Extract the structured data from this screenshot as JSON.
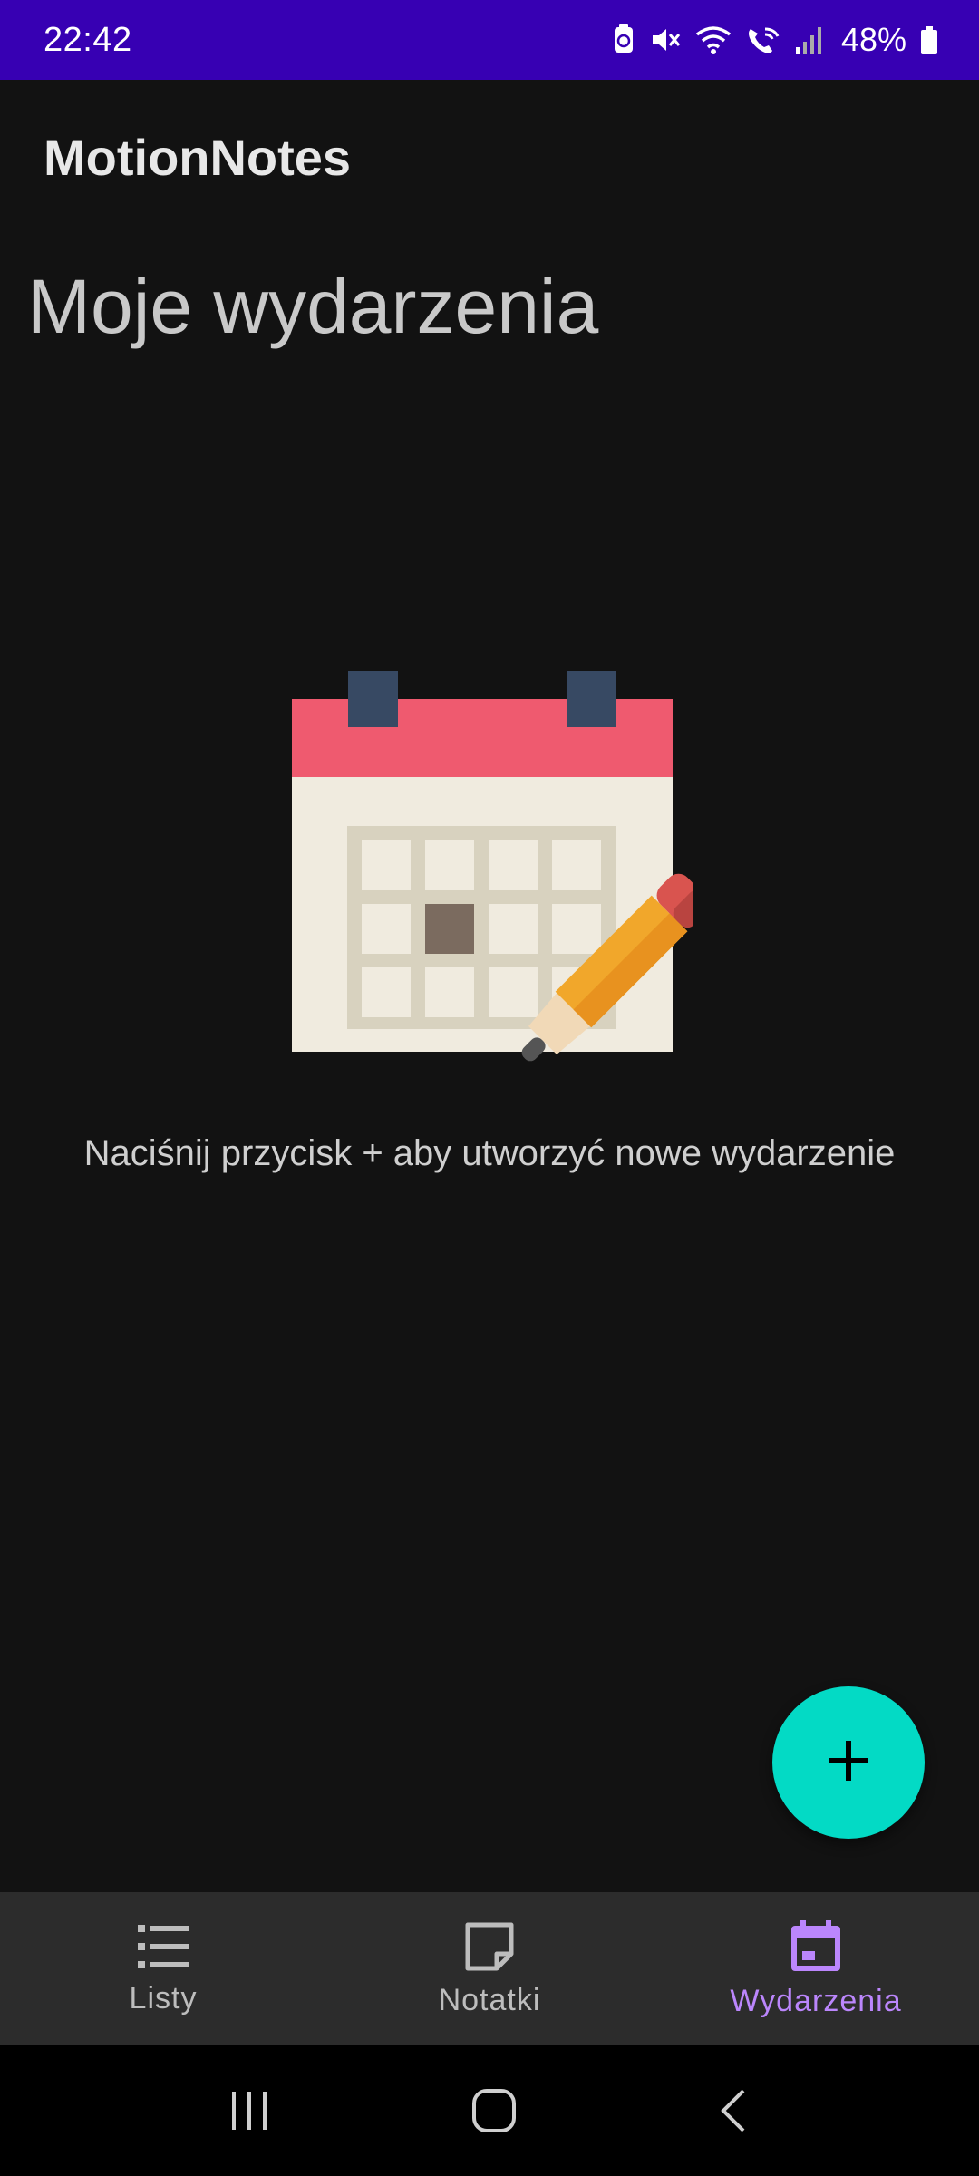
{
  "status_bar": {
    "time": "22:42",
    "battery_percent": "48%",
    "icons": [
      "battery-saver-icon",
      "mute-icon",
      "wifi-icon",
      "wifi-calling-icon",
      "signal-icon",
      "battery-icon"
    ]
  },
  "app_bar": {
    "title": "MotionNotes"
  },
  "page": {
    "title": "Moje wydarzenia",
    "empty_message": "Naciśnij przycisk + aby utworzyć nowe wydarzenie",
    "illustration": "calendar-with-pencil-icon"
  },
  "fab": {
    "icon": "plus-icon",
    "color": "#03dac5"
  },
  "bottom_nav": {
    "items": [
      {
        "label": "Listy",
        "icon": "list-icon",
        "active": false
      },
      {
        "label": "Notatki",
        "icon": "note-icon",
        "active": false
      },
      {
        "label": "Wydarzenia",
        "icon": "calendar-icon",
        "active": true
      }
    ],
    "active_color": "#bb86fc"
  },
  "system_nav": {
    "icons": [
      "recents-icon",
      "home-icon",
      "back-icon"
    ]
  },
  "colors": {
    "status_bar": "#3700b3",
    "background": "#121212",
    "nav_background": "#2c2c2c"
  }
}
